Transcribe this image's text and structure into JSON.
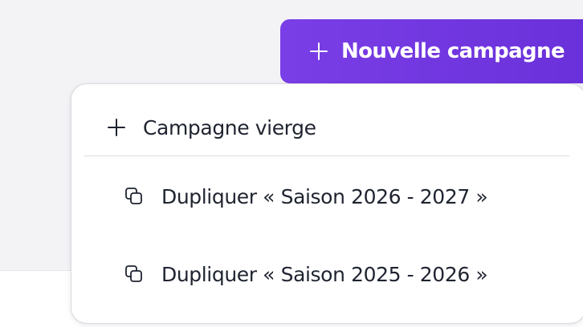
{
  "header": {
    "new_campaign_label": "Nouvelle campagne",
    "new_campaign_icon": "plus-icon",
    "accent_color": "#7a3ee6"
  },
  "dropdown": {
    "items": [
      {
        "label": "Campagne vierge",
        "icon": "plus-icon"
      },
      {
        "label": "Dupliquer « Saison 2026 - 2027 »",
        "icon": "copy-icon"
      },
      {
        "label": "Dupliquer « Saison 2025 - 2026 »",
        "icon": "copy-icon"
      }
    ]
  }
}
